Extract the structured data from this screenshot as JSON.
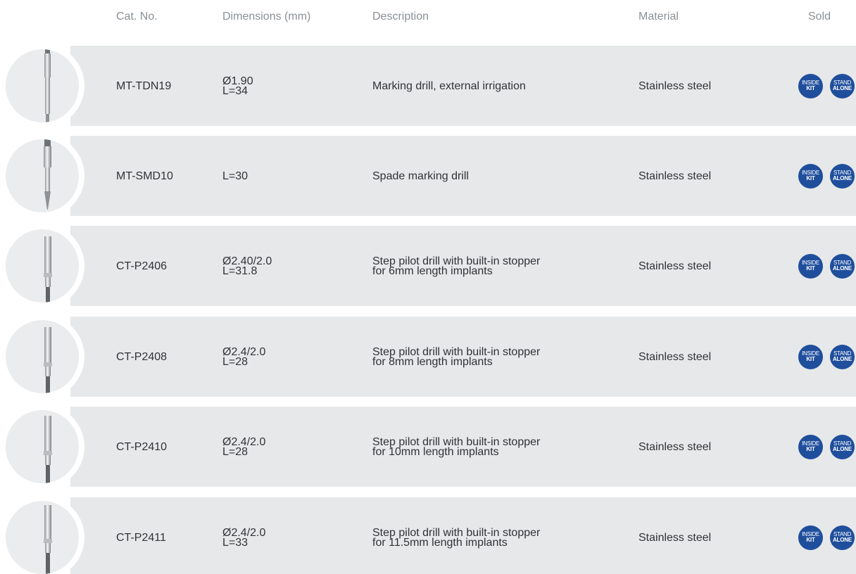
{
  "header": {
    "cat_no": "Cat. No.",
    "dimensions": "Dimensions  (mm)",
    "description": "Description",
    "material": "Material",
    "sold": "Sold"
  },
  "badges": {
    "inside_top": "INSIDE",
    "inside_bottom": "KIT",
    "stand_top": "STAND",
    "stand_bottom": "ALONE",
    "color": "#1f4e9c"
  },
  "rows": [
    {
      "cat_no": "MT-TDN19",
      "dim1": "Ø1.90",
      "dim2": "L=34",
      "desc1": "Marking drill, external irrigation",
      "desc2": "",
      "material": "Stainless steel",
      "icon": "marking-drill-icon"
    },
    {
      "cat_no": "MT-SMD10",
      "dim1": "L=30",
      "dim2": "",
      "desc1": "Spade marking drill",
      "desc2": "",
      "material": "Stainless steel",
      "icon": "spade-drill-icon"
    },
    {
      "cat_no": "CT-P2406",
      "dim1": "Ø2.40/2.0",
      "dim2": "L=31.8",
      "desc1": "Step pilot drill with built-in stopper",
      "desc2": "for 6mm length implants",
      "material": "Stainless steel",
      "icon": "step-pilot-drill-icon"
    },
    {
      "cat_no": "CT-P2408",
      "dim1": "Ø2.4/2.0",
      "dim2": "L=28",
      "desc1": "Step pilot drill with built-in stopper",
      "desc2": "for 8mm length implants",
      "material": "Stainless steel",
      "icon": "step-pilot-drill-icon"
    },
    {
      "cat_no": "CT-P2410",
      "dim1": "Ø2.4/2.0",
      "dim2": "L=28",
      "desc1": "Step pilot drill with built-in stopper",
      "desc2": "for 10mm length implants",
      "material": "Stainless steel",
      "icon": "step-pilot-drill-icon"
    },
    {
      "cat_no": "CT-P2411",
      "dim1": "Ø2.4/2.0",
      "dim2": "L=33",
      "desc1": "Step pilot drill with built-in stopper",
      "desc2": "for 11.5mm length implants",
      "material": "Stainless steel",
      "icon": "step-pilot-drill-icon"
    }
  ]
}
